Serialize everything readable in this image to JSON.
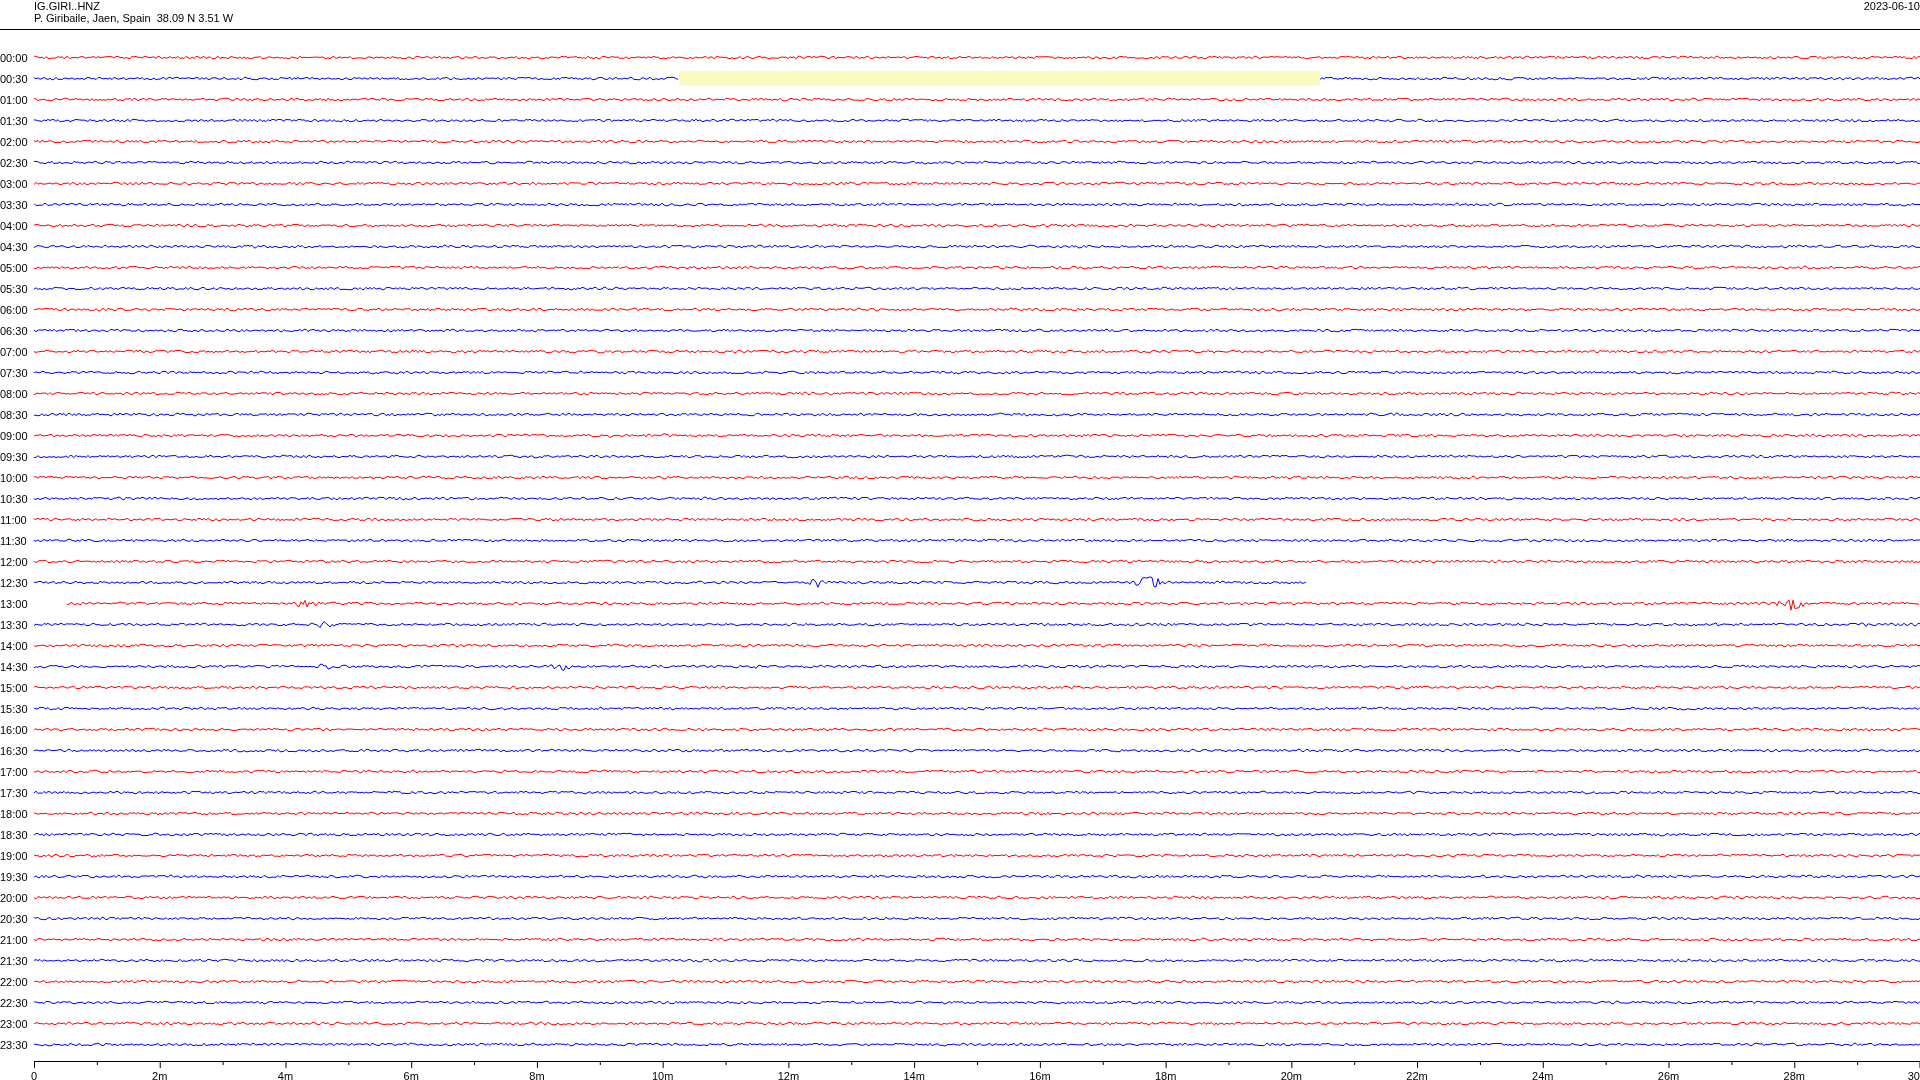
{
  "header": {
    "station": "IG.GIRI..HNZ",
    "location": "P. Giribaile, Jaen, Spain  38.09 N 3.51 W",
    "date": "2023-06-10"
  },
  "rows": [
    {
      "time": "00:00",
      "color": "#ff0000"
    },
    {
      "time": "00:30",
      "color": "#0000ff"
    },
    {
      "time": "01:00",
      "color": "#ff0000"
    },
    {
      "time": "01:30",
      "color": "#0000ff"
    },
    {
      "time": "02:00",
      "color": "#ff0000"
    },
    {
      "time": "02:30",
      "color": "#0000ff"
    },
    {
      "time": "03:00",
      "color": "#ff0000"
    },
    {
      "time": "03:30",
      "color": "#0000ff"
    },
    {
      "time": "04:00",
      "color": "#ff0000"
    },
    {
      "time": "04:30",
      "color": "#0000ff"
    },
    {
      "time": "05:00",
      "color": "#ff0000"
    },
    {
      "time": "05:30",
      "color": "#0000ff"
    },
    {
      "time": "06:00",
      "color": "#ff0000"
    },
    {
      "time": "06:30",
      "color": "#0000ff"
    },
    {
      "time": "07:00",
      "color": "#ff0000"
    },
    {
      "time": "07:30",
      "color": "#0000ff"
    },
    {
      "time": "08:00",
      "color": "#ff0000"
    },
    {
      "time": "08:30",
      "color": "#0000ff"
    },
    {
      "time": "09:00",
      "color": "#ff0000"
    },
    {
      "time": "09:30",
      "color": "#0000ff"
    },
    {
      "time": "10:00",
      "color": "#ff0000"
    },
    {
      "time": "10:30",
      "color": "#0000ff"
    },
    {
      "time": "11:00",
      "color": "#ff0000"
    },
    {
      "time": "11:30",
      "color": "#0000ff"
    },
    {
      "time": "12:00",
      "color": "#ff0000"
    },
    {
      "time": "12:30",
      "color": "#0000ff"
    },
    {
      "time": "13:00",
      "color": "#ff0000"
    },
    {
      "time": "13:30",
      "color": "#0000ff"
    },
    {
      "time": "14:00",
      "color": "#ff0000"
    },
    {
      "time": "14:30",
      "color": "#0000ff"
    },
    {
      "time": "15:00",
      "color": "#ff0000"
    },
    {
      "time": "15:30",
      "color": "#0000ff"
    },
    {
      "time": "16:00",
      "color": "#ff0000"
    },
    {
      "time": "16:30",
      "color": "#0000ff"
    },
    {
      "time": "17:00",
      "color": "#ff0000"
    },
    {
      "time": "17:30",
      "color": "#0000ff"
    },
    {
      "time": "18:00",
      "color": "#ff0000"
    },
    {
      "time": "18:30",
      "color": "#0000ff"
    },
    {
      "time": "19:00",
      "color": "#ff0000"
    },
    {
      "time": "19:30",
      "color": "#0000ff"
    },
    {
      "time": "20:00",
      "color": "#ff0000"
    },
    {
      "time": "20:30",
      "color": "#0000ff"
    },
    {
      "time": "21:00",
      "color": "#ff0000"
    },
    {
      "time": "21:30",
      "color": "#0000ff"
    },
    {
      "time": "22:00",
      "color": "#ff0000"
    },
    {
      "time": "22:30",
      "color": "#0000ff"
    },
    {
      "time": "23:00",
      "color": "#ff0000"
    },
    {
      "time": "23:30",
      "color": "#0000ff"
    }
  ],
  "x_axis": {
    "labels": [
      "0",
      "2m",
      "4m",
      "6m",
      "8m",
      "10m",
      "12m",
      "14m",
      "16m",
      "18m",
      "20m",
      "22m",
      "24m",
      "26m",
      "28m",
      "30"
    ]
  }
}
